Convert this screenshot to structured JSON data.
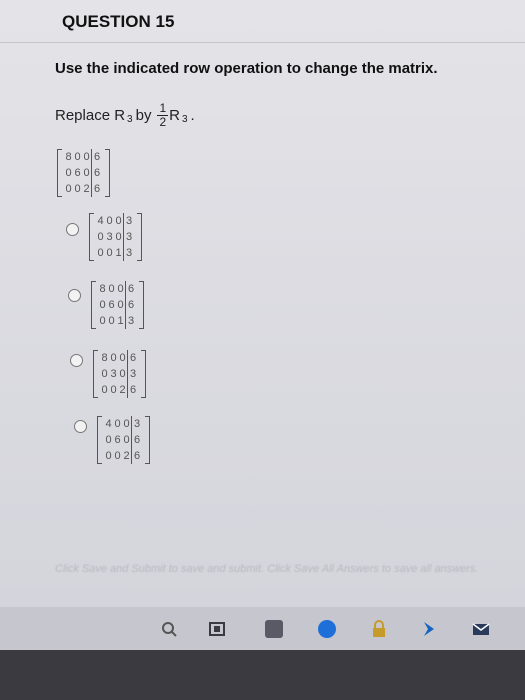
{
  "question": {
    "title": "QUESTION 15"
  },
  "instruction": "Use the indicated row operation to change the matrix.",
  "operation": {
    "prefix": "Replace R",
    "row": "3",
    "by": "by",
    "numerator": "1",
    "denominator": "2",
    "target": "R",
    "target_row": "3",
    "end": "."
  },
  "given_matrix": [
    [
      "8",
      "0",
      "0",
      "6"
    ],
    [
      "0",
      "6",
      "0",
      "6"
    ],
    [
      "0",
      "0",
      "2",
      "6"
    ]
  ],
  "options": [
    {
      "matrix": [
        [
          "4",
          "0",
          "0",
          "3"
        ],
        [
          "0",
          "3",
          "0",
          "3"
        ],
        [
          "0",
          "0",
          "1",
          "3"
        ]
      ],
      "selected": false
    },
    {
      "matrix": [
        [
          "8",
          "0",
          "0",
          "6"
        ],
        [
          "0",
          "6",
          "0",
          "6"
        ],
        [
          "0",
          "0",
          "1",
          "3"
        ]
      ],
      "selected": false
    },
    {
      "matrix": [
        [
          "8",
          "0",
          "0",
          "6"
        ],
        [
          "0",
          "3",
          "0",
          "3"
        ],
        [
          "0",
          "0",
          "2",
          "6"
        ]
      ],
      "selected": false
    },
    {
      "matrix": [
        [
          "4",
          "0",
          "0",
          "3"
        ],
        [
          "0",
          "6",
          "0",
          "6"
        ],
        [
          "0",
          "0",
          "2",
          "6"
        ]
      ],
      "selected": false
    }
  ],
  "footer": "Click Save and Submit to save and submit. Click Save All Answers to save all answers.",
  "taskbar": {
    "icons": [
      "search-icon",
      "edge-browser-icon",
      "file-explorer-icon",
      "store-icon",
      "lock-icon",
      "vpn-icon",
      "mail-icon"
    ]
  },
  "colors": {
    "accent": "#1565c0",
    "matrix_text": "#555555",
    "footer_text": "#b8b8c0"
  }
}
